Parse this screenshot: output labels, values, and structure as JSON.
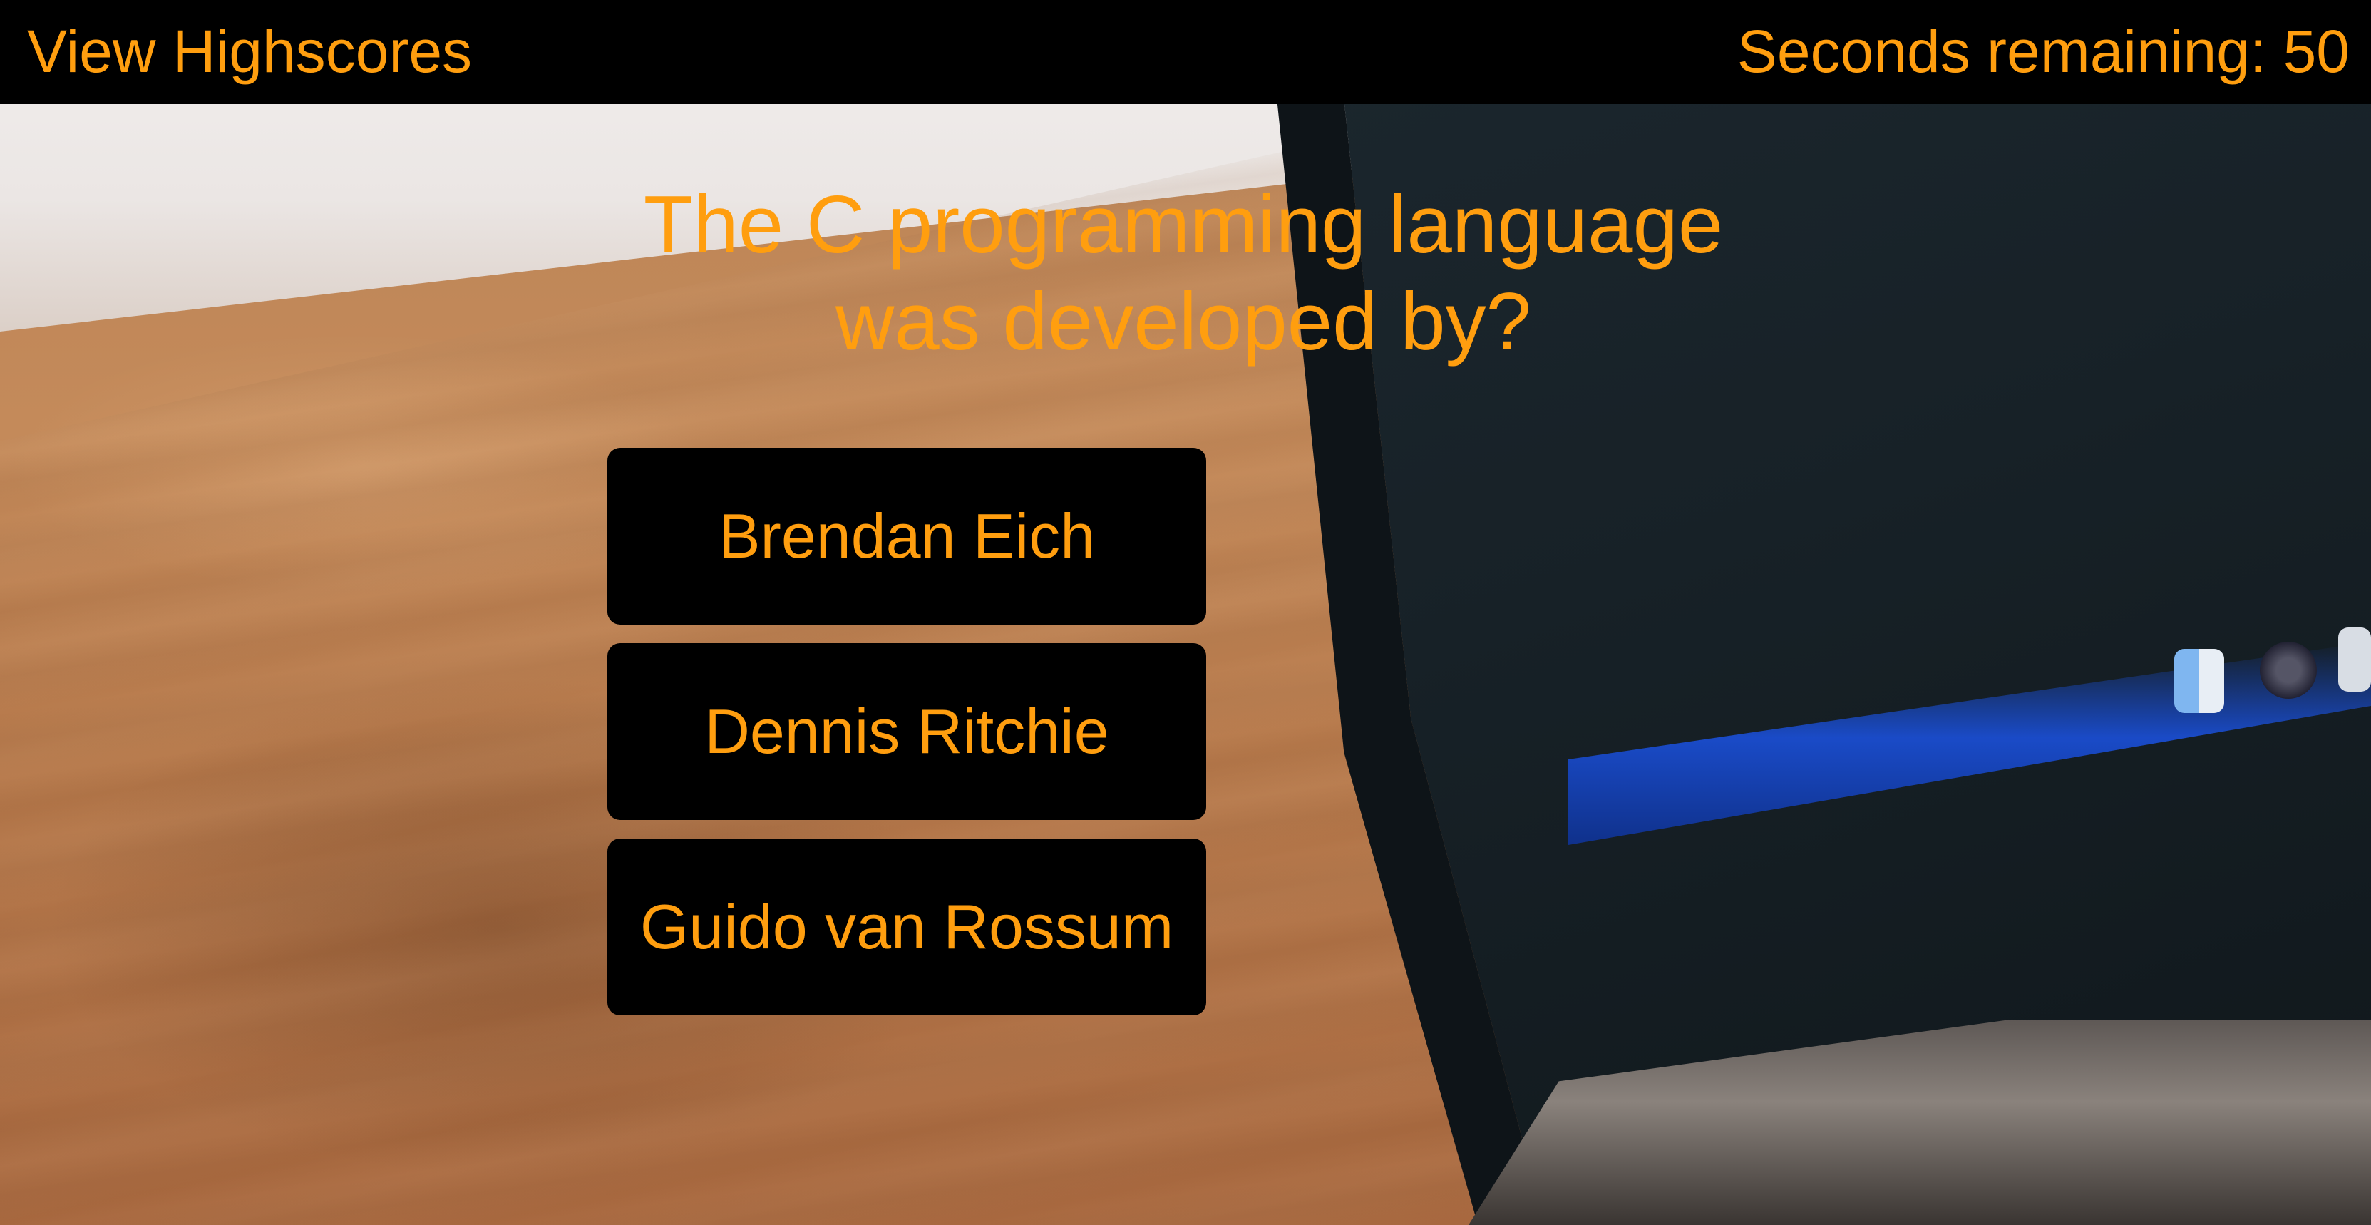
{
  "header": {
    "highscores_label": "View Highscores",
    "timer_label": "Seconds remaining:",
    "seconds_remaining": 50
  },
  "quiz": {
    "question_line1": "The C programming language",
    "question_line2": "was developed by?",
    "answers": [
      "Brendan Eich",
      "Dennis Ritchie",
      "Guido van Rossum"
    ]
  },
  "colors": {
    "accent": "#ff9e0f",
    "bar_background": "#000000",
    "button_background": "#000000"
  },
  "background": {
    "description_icon": "laptop-on-desk-photo"
  }
}
